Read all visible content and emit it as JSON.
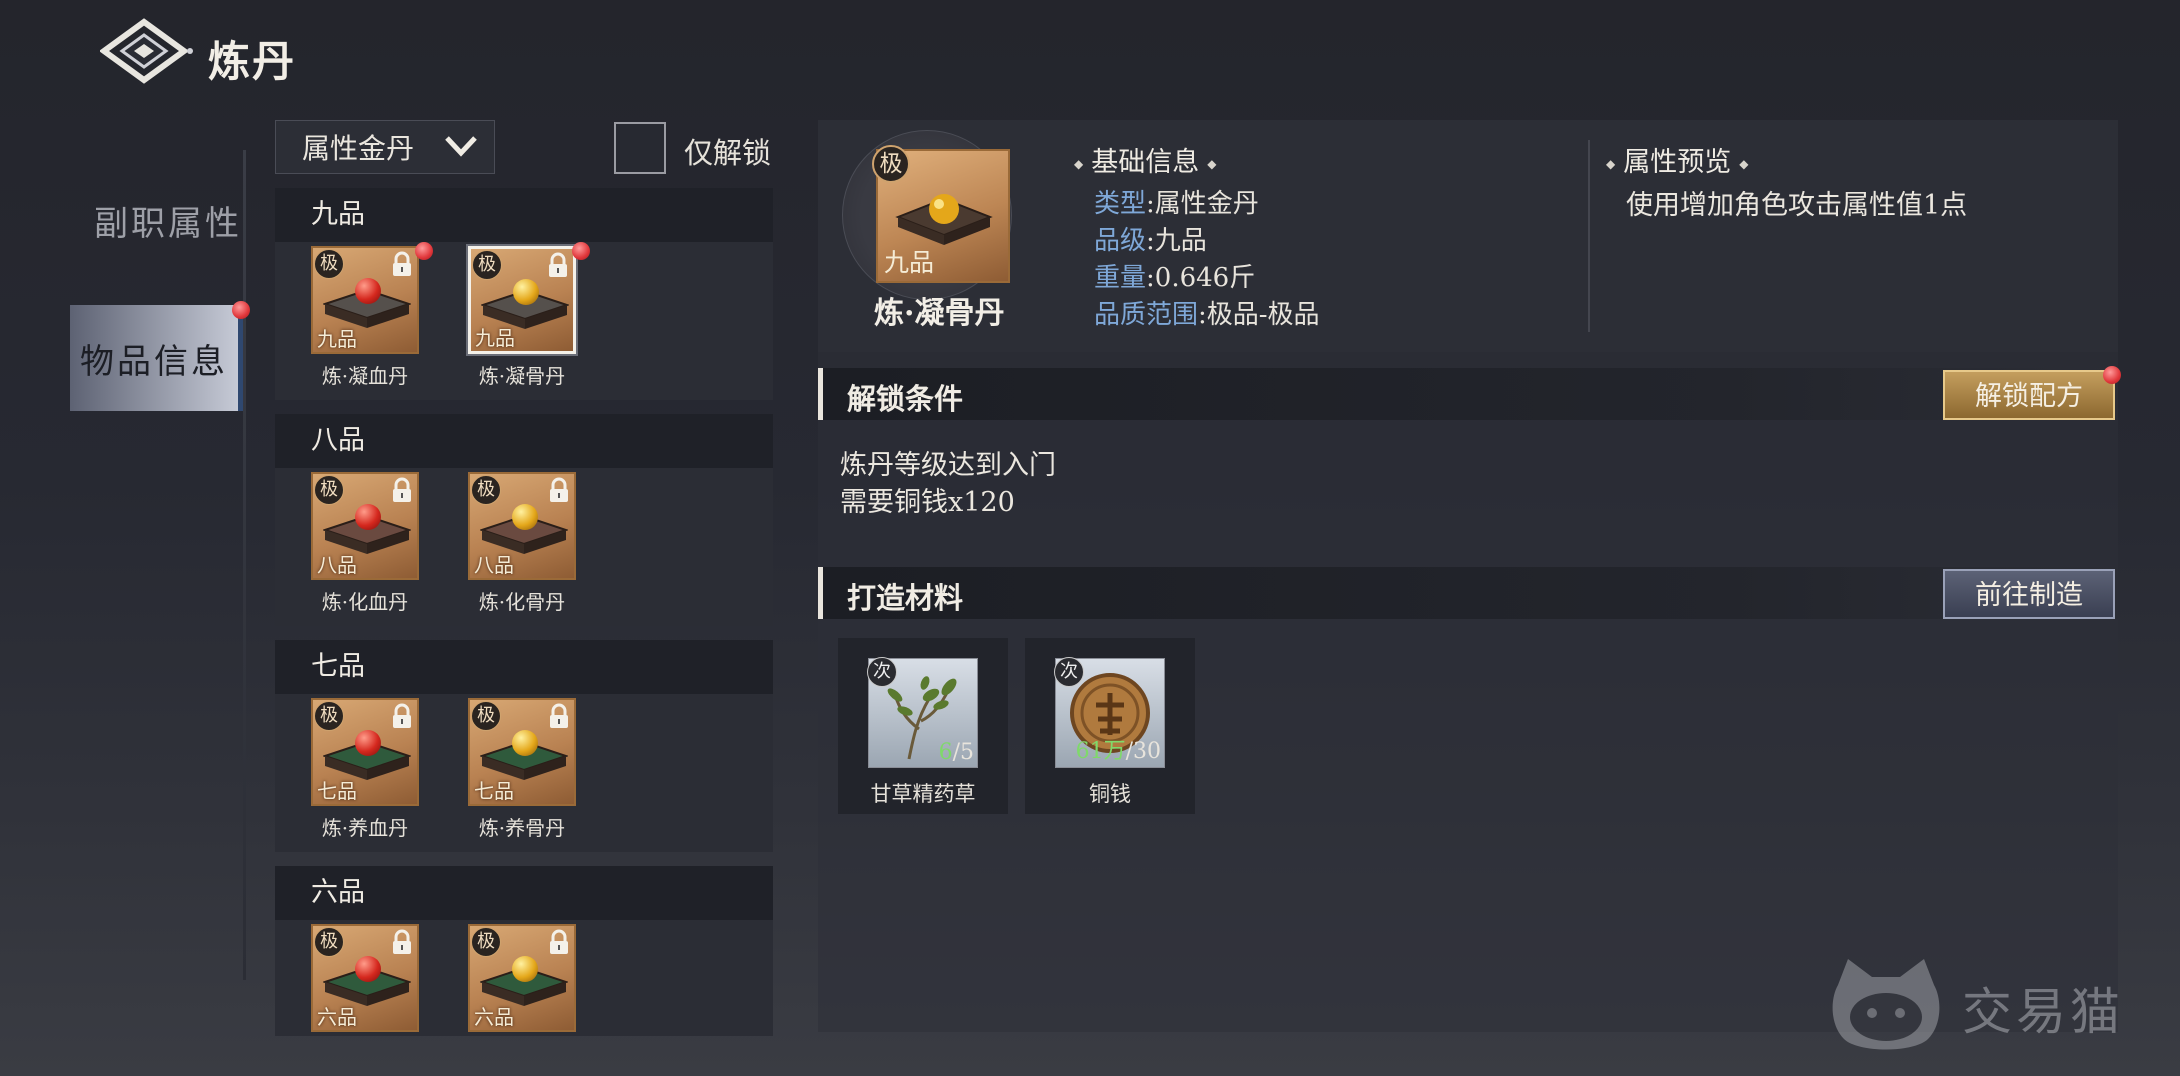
{
  "title": "炼丹",
  "nav": {
    "items": [
      {
        "label": "副职属性",
        "active": false
      },
      {
        "label": "物品信息",
        "active": true
      }
    ]
  },
  "filter": {
    "dropdown_value": "属性金丹",
    "only_unlocked_label": "仅解锁",
    "only_unlocked_checked": false
  },
  "groups": [
    {
      "label": "九品",
      "items": [
        {
          "name": "炼·凝血丹",
          "tier": "极",
          "grade": "九品",
          "pill": "red",
          "locked": true,
          "new": true
        },
        {
          "name": "炼·凝骨丹",
          "tier": "极",
          "grade": "九品",
          "pill": "gold",
          "locked": true,
          "new": true,
          "selected": true
        }
      ]
    },
    {
      "label": "八品",
      "items": [
        {
          "name": "炼·化血丹",
          "tier": "极",
          "grade": "八品",
          "pill": "red",
          "locked": true
        },
        {
          "name": "炼·化骨丹",
          "tier": "极",
          "grade": "八品",
          "pill": "gold",
          "locked": true
        }
      ]
    },
    {
      "label": "七品",
      "items": [
        {
          "name": "炼·养血丹",
          "tier": "极",
          "grade": "七品",
          "pill": "red",
          "locked": true
        },
        {
          "name": "炼·养骨丹",
          "tier": "极",
          "grade": "七品",
          "pill": "gold",
          "locked": true
        }
      ]
    },
    {
      "label": "六品",
      "items": [
        {
          "name": "",
          "tier": "极",
          "grade": "六品",
          "pill": "red",
          "locked": true
        },
        {
          "name": "",
          "tier": "极",
          "grade": "六品",
          "pill": "gold",
          "locked": true
        }
      ]
    }
  ],
  "detail": {
    "tier": "极",
    "grade": "九品",
    "name": "炼·凝骨丹",
    "basic_info_title": "基础信息",
    "fields": [
      {
        "key": "类型",
        "value": ":属性金丹"
      },
      {
        "key": "品级",
        "value": ":九品"
      },
      {
        "key": "重量",
        "value": ":0.646斤"
      },
      {
        "key": "品质范围",
        "value": ":极品-极品"
      }
    ],
    "preview_title": "属性预览",
    "preview_text": "使用增加角色攻击属性值1点"
  },
  "unlock": {
    "title": "解锁条件",
    "button": "解锁配方",
    "lines": [
      "炼丹等级达到入门",
      "需要铜钱x120"
    ]
  },
  "materials": {
    "title": "打造材料",
    "button": "前往制造",
    "items": [
      {
        "name": "甘草精药草",
        "tier": "次",
        "have": "6",
        "need": "/5",
        "icon": "herb-icon"
      },
      {
        "name": "铜钱",
        "tier": "次",
        "have": "61万",
        "need": "/30",
        "icon": "coin-icon"
      }
    ]
  },
  "watermark": {
    "text": "交易猫"
  },
  "colors": {
    "accent_blue": "#7fa8d8",
    "gold_button": "#c49e5e",
    "red_dot": "#e0363a",
    "count_green": "#7fd96a"
  }
}
